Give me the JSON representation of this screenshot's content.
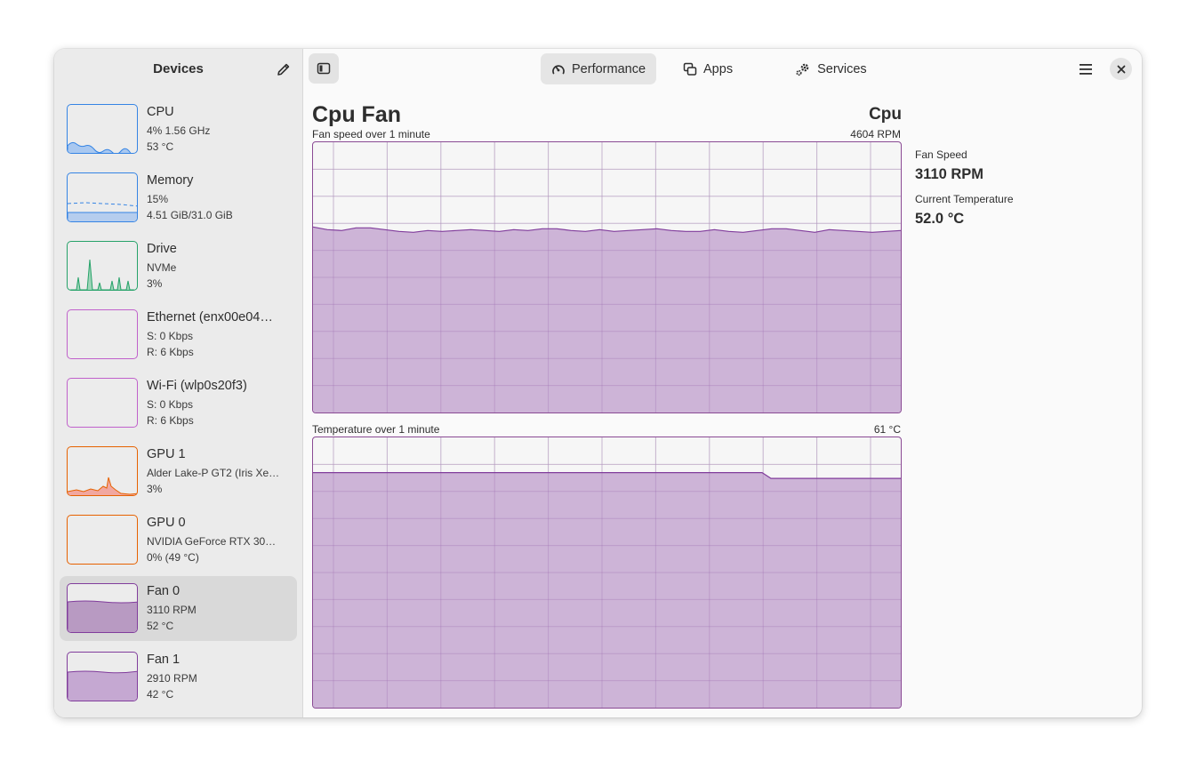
{
  "sidebar": {
    "title": "Devices",
    "devices": [
      {
        "name": "CPU",
        "line1": "4% 1.56 GHz",
        "line2": "53 °C",
        "color": "#3584e4",
        "fill": "#a9c8f0"
      },
      {
        "name": "Memory",
        "line1": "15%",
        "line2": "4.51 GiB/31.0 GiB",
        "color": "#3584e4",
        "fill": "#b5cdee"
      },
      {
        "name": "Drive",
        "line1": "NVMe",
        "line2": "3%",
        "color": "#26a269",
        "fill": "#9ed4b8"
      },
      {
        "name": "Ethernet (enx00e04…",
        "line1": "S: 0 Kbps",
        "line2": "R: 6 Kbps",
        "color": "#c061cb",
        "fill": "#e3c4e8"
      },
      {
        "name": "Wi-Fi (wlp0s20f3)",
        "line1": "S: 0 Kbps",
        "line2": "R: 6 Kbps",
        "color": "#c061cb",
        "fill": "#e3c4e8"
      },
      {
        "name": "GPU 1",
        "line1": "Alder Lake-P GT2 (Iris Xe …",
        "line2": "3%",
        "color": "#e66100",
        "fill": "#f1a7a0"
      },
      {
        "name": "GPU 0",
        "line1": "NVIDIA GeForce RTX 305…",
        "line2": "0% (49 °C)",
        "color": "#e66100",
        "fill": "#f1a7a0"
      },
      {
        "name": "Fan 0",
        "line1": "3110 RPM",
        "line2": "52 °C",
        "color": "#813d9c",
        "fill": "#b89ac2",
        "selected": true
      },
      {
        "name": "Fan 1",
        "line1": "2910 RPM",
        "line2": "42 °C",
        "color": "#813d9c",
        "fill": "#c5a8d2"
      }
    ]
  },
  "tabs": [
    {
      "label": "Performance",
      "icon": "speedometer-icon",
      "active": true
    },
    {
      "label": "Apps",
      "icon": "windows-icon",
      "active": false
    },
    {
      "label": "Services",
      "icon": "gears-icon",
      "active": false
    }
  ],
  "page": {
    "title": "Cpu Fan",
    "subtitle": "Cpu"
  },
  "graphs": {
    "fan": {
      "label": "Fan speed over 1 minute",
      "max": "4604 RPM",
      "fraction": 0.68
    },
    "temp": {
      "label": "Temperature over 1 minute",
      "max": "61 °C",
      "fraction": 0.85
    }
  },
  "info": {
    "fan_speed_label": "Fan Speed",
    "fan_speed_value": "3110 RPM",
    "temp_label": "Current Temperature",
    "temp_value": "52.0 °C"
  },
  "colors": {
    "graph_stroke": "#813d9c",
    "graph_fill": "#c9aed4"
  }
}
